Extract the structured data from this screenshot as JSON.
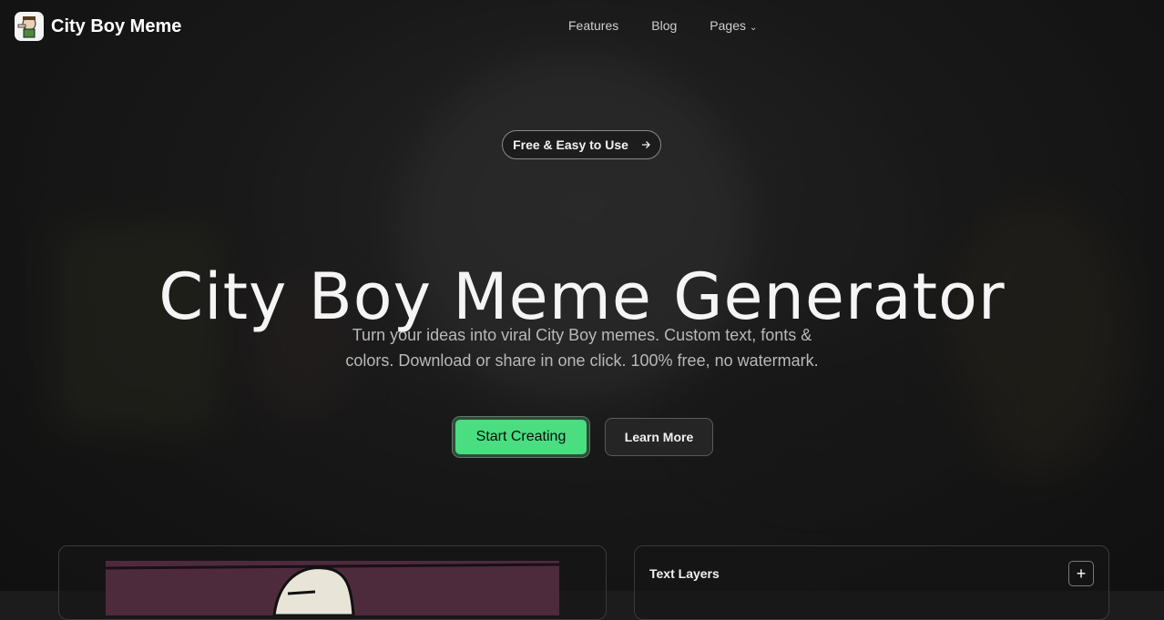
{
  "brand": {
    "name": "City Boy Meme",
    "logo_icon": "city-boy-logo-icon"
  },
  "nav": {
    "items": [
      {
        "label": "Features"
      },
      {
        "label": "Blog"
      },
      {
        "label": "Pages",
        "has_dropdown": true
      }
    ],
    "dropdown_icon": "chevron-down-icon"
  },
  "hero": {
    "badge": {
      "label": "Free & Easy to Use",
      "icon": "arrow-right-icon"
    },
    "title": "City Boy Meme Generator",
    "subtitle_line1": "Turn your ideas into viral City Boy memes. Custom text, fonts &",
    "subtitle_line2": "colors. Download or share in one click. 100% free, no watermark.",
    "primary_cta": "Start Creating",
    "secondary_cta": "Learn More"
  },
  "editor": {
    "layers_title": "Text Layers",
    "add_icon": "plus-icon",
    "add_symbol": "+"
  },
  "colors": {
    "accent": "#4ade80",
    "background": "#1c1c1c",
    "text": "#ffffff"
  }
}
